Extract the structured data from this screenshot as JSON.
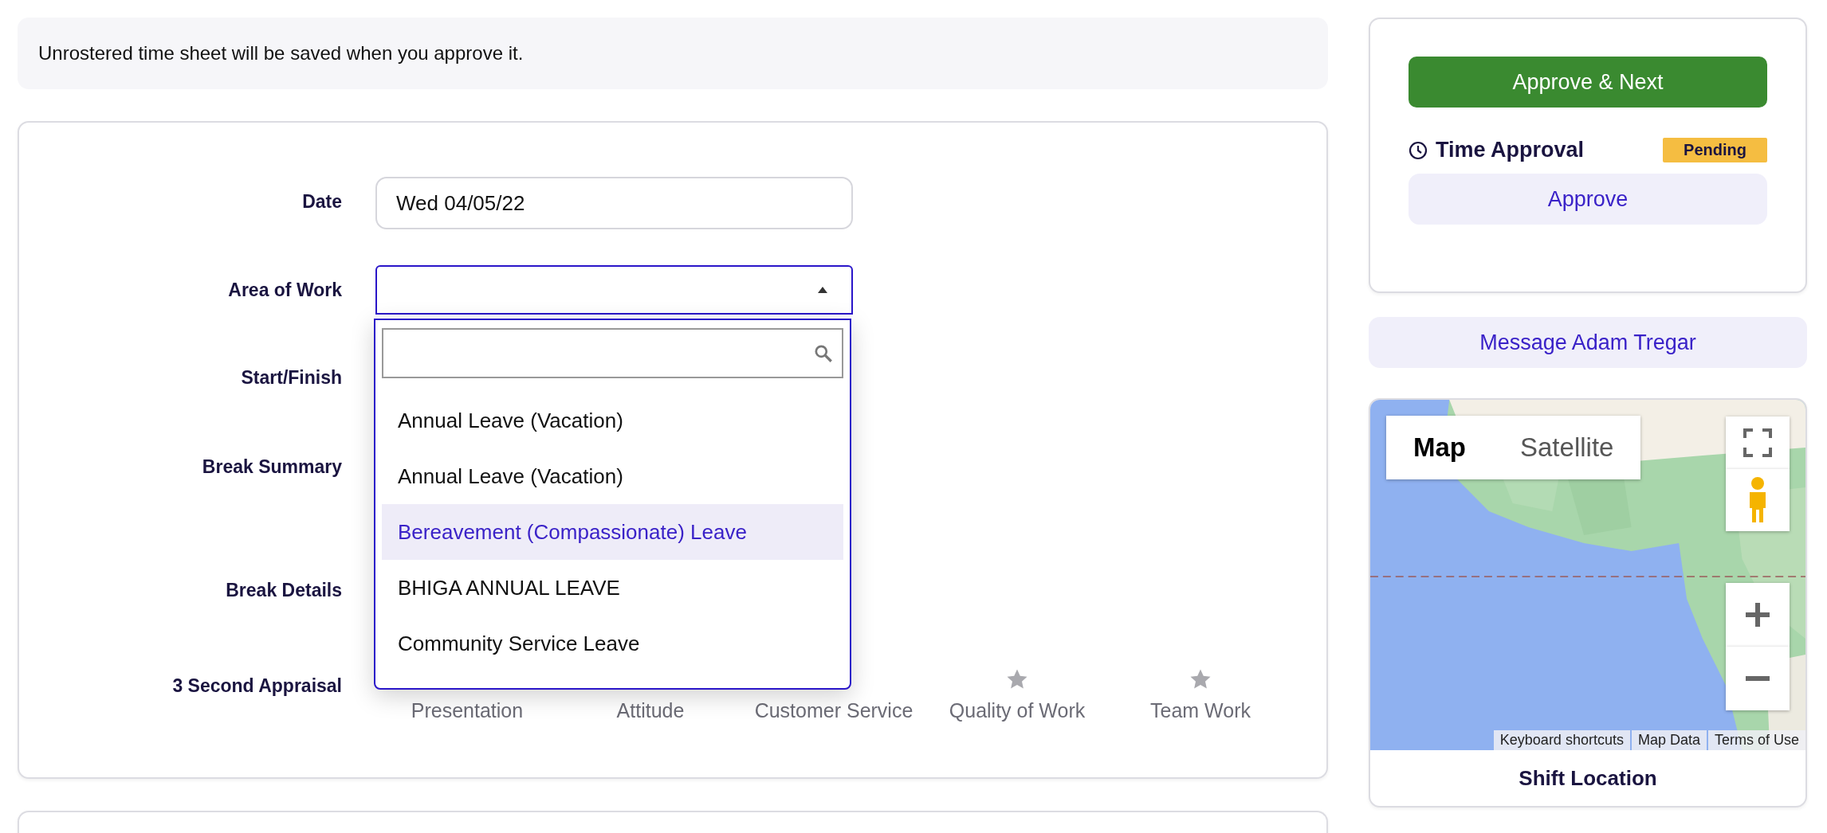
{
  "notice": "Unrostered time sheet will be saved when you approve it.",
  "form": {
    "fields": [
      {
        "label": "Date",
        "kind": "text",
        "value": "Wed 04/05/22"
      },
      {
        "label": "Area of Work",
        "kind": "select",
        "expanded": true
      },
      {
        "label": "Start/Finish",
        "kind": "blank"
      },
      {
        "label": "Break Summary",
        "kind": "blank"
      },
      {
        "label": "Break Details",
        "kind": "blank"
      },
      {
        "label": "3 Second Appraisal",
        "kind": "appraisal",
        "items": [
          {
            "label": "Presentation"
          },
          {
            "label": "Attitude"
          },
          {
            "label": "Customer Service"
          },
          {
            "label": "Quality of Work",
            "kind": "rated",
            "rated": false
          },
          {
            "label": "Team Work",
            "kind": "rated",
            "rated": false
          }
        ]
      }
    ]
  },
  "dropdown": {
    "options": [
      {
        "label": "Annual Leave (Vacation)",
        "selected": false
      },
      {
        "label": "Annual Leave (Vacation)",
        "selected": false
      },
      {
        "label": "Bereavement (Compassionate) Leave",
        "selected": true
      },
      {
        "label": "BHIGA ANNUAL LEAVE",
        "selected": false
      },
      {
        "label": "Community Service Leave",
        "selected": false
      }
    ]
  },
  "approval_card": {
    "primary_button": "Approve & Next",
    "section_title": "Time Approval",
    "status": "Pending",
    "button": "Approve"
  },
  "message_button": "Message Adam Tregar",
  "map": {
    "map_types": [
      {
        "label": "Map",
        "selected": true
      },
      {
        "label": "Satellite",
        "selected": false
      }
    ],
    "attribution": [
      "Keyboard shortcuts",
      "Map Data",
      "Terms of Use"
    ],
    "caption": "Shift Location"
  }
}
